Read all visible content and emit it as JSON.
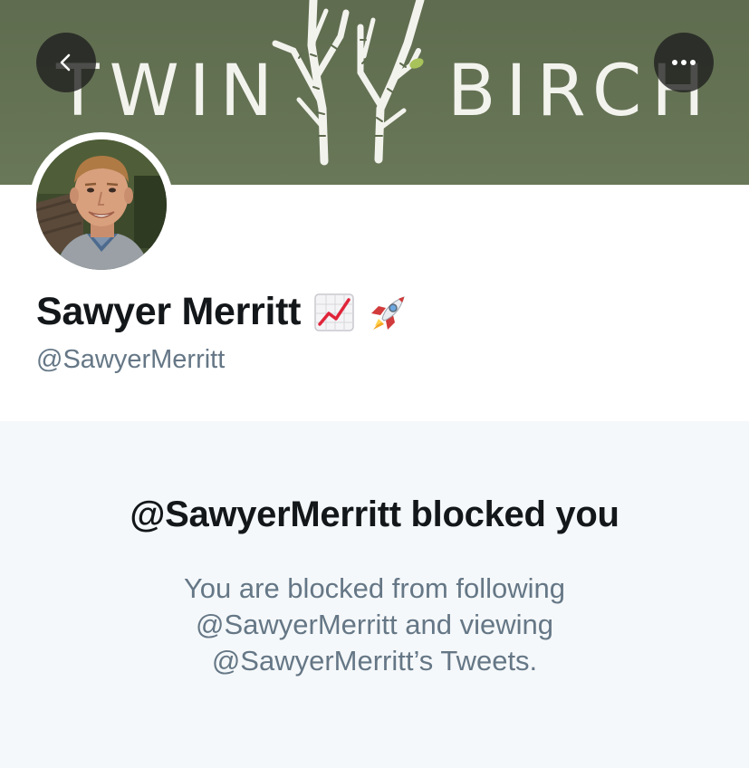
{
  "banner": {
    "word_left": "TWIN",
    "word_right": "BIRCH",
    "logo_icon": "birch-trees-icon",
    "background_color": "#646f52"
  },
  "nav": {
    "back_icon": "chevron-left-icon",
    "more_icon": "ellipsis-icon",
    "more_label": "···"
  },
  "profile": {
    "avatar_icon": "profile-photo",
    "name": "Sawyer Merritt",
    "name_emojis": [
      "chart-increasing-icon",
      "rocket-icon"
    ],
    "handle": "@SawyerMerritt"
  },
  "blocked": {
    "title": "@SawyerMerritt blocked you",
    "line1": "You are blocked from following",
    "line2": "@SawyerMerritt and viewing",
    "line3": "@SawyerMerritt’s Tweets."
  },
  "colors": {
    "text_primary": "#14171a",
    "text_secondary": "#657786",
    "panel_bg": "#f5f8fa"
  }
}
